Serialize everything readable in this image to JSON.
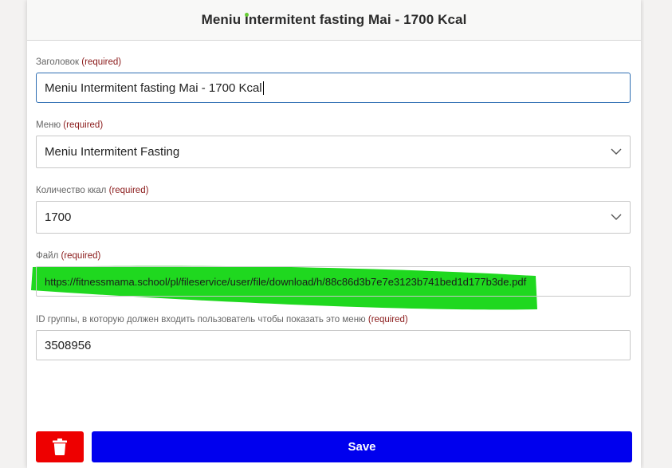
{
  "header": {
    "title": "Meniu Intermitent fasting Mai - 1700 Kcal"
  },
  "required_marker": "(required)",
  "fields": {
    "title": {
      "label": "Заголовок",
      "value": "Meniu Intermitent fasting Mai - 1700 Kcal"
    },
    "menu": {
      "label": "Меню",
      "value": "Meniu Intermitent Fasting"
    },
    "kcal": {
      "label": "Количество ккал",
      "value": "1700"
    },
    "file": {
      "label": "Файл",
      "value": "https://fitnessmama.school/pl/fileservice/user/file/download/h/88c86d3b7e7e3123b741bed1d177b3de.pdf"
    },
    "group_id": {
      "label": "ID группы, в которую должен входить пользователь чтобы показать это меню",
      "value": "3508956"
    }
  },
  "actions": {
    "save_label": "Save",
    "delete_icon": "trash-icon"
  },
  "colors": {
    "save_button": "#0000ee",
    "delete_button": "#ee0000",
    "highlight": "#1fd81f",
    "status_dot": "#66cc33",
    "focus_border": "#2f6fb3",
    "required_text": "#8a1a1a"
  }
}
